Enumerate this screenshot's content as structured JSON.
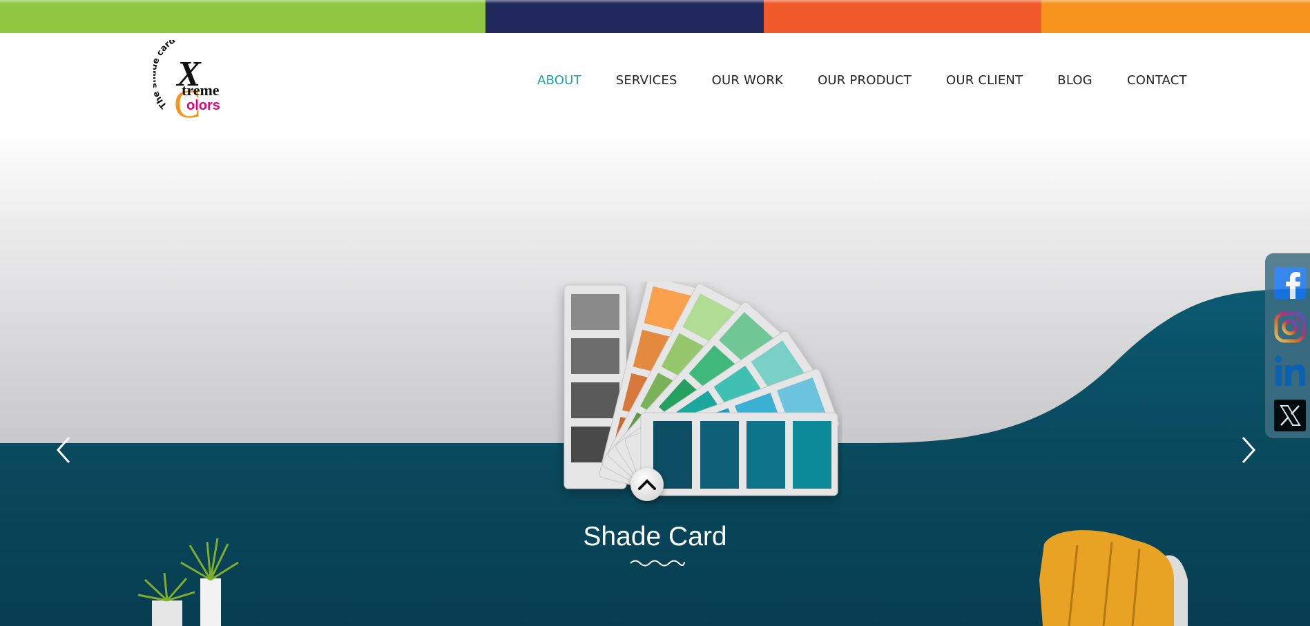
{
  "brand": {
    "tagline": "The shade card story",
    "name_part1": "treme",
    "name_part2": "olors",
    "logo_letter_x": "X",
    "logo_letter_c": "C"
  },
  "colors": {
    "bar": [
      "#8dc63f",
      "#21295c",
      "#f15a2b",
      "#f7941d"
    ],
    "nav_active": "#1aa3a0",
    "teal": "#0c4e63"
  },
  "nav": {
    "items": [
      {
        "label": "ABOUT",
        "active": true
      },
      {
        "label": "SERVICES",
        "active": false
      },
      {
        "label": "OUR WORK",
        "active": false
      },
      {
        "label": "OUR PRODUCT",
        "active": false
      },
      {
        "label": "OUR CLIENT",
        "active": false
      },
      {
        "label": "BLOG",
        "active": false
      },
      {
        "label": "CONTACT",
        "active": false
      }
    ]
  },
  "hero": {
    "caption": "Shade Card",
    "prev_icon": "chevron-left-icon",
    "next_icon": "chevron-right-icon",
    "scroll_icon": "chevron-up-icon"
  },
  "social": [
    {
      "name": "facebook-icon"
    },
    {
      "name": "instagram-icon"
    },
    {
      "name": "linkedin-icon"
    },
    {
      "name": "x-twitter-icon"
    }
  ]
}
